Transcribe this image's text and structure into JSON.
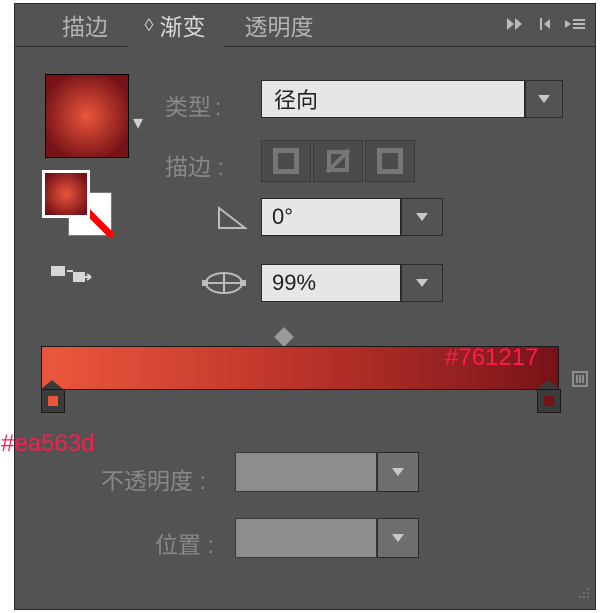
{
  "tabs": {
    "stroke": "描边",
    "gradient": "渐变",
    "transparency": "透明度"
  },
  "labels": {
    "type": "类型",
    "stroke": "描边",
    "opacity": "不透明度",
    "position": "位置"
  },
  "values": {
    "type": "径向",
    "angle": "0°",
    "aspect": "99%",
    "opacity": "",
    "position": ""
  },
  "gradient": {
    "stops": [
      {
        "color": "#ea563d",
        "position": 0
      },
      {
        "color": "#761217",
        "position": 100
      }
    ],
    "type": "radial"
  },
  "annotations": {
    "left": "#ea563d",
    "right": "#761217"
  },
  "colors": {
    "panel_bg": "#535353",
    "left_stop": "#ea563d",
    "right_stop": "#761217",
    "annotation": "#ff1a52"
  }
}
